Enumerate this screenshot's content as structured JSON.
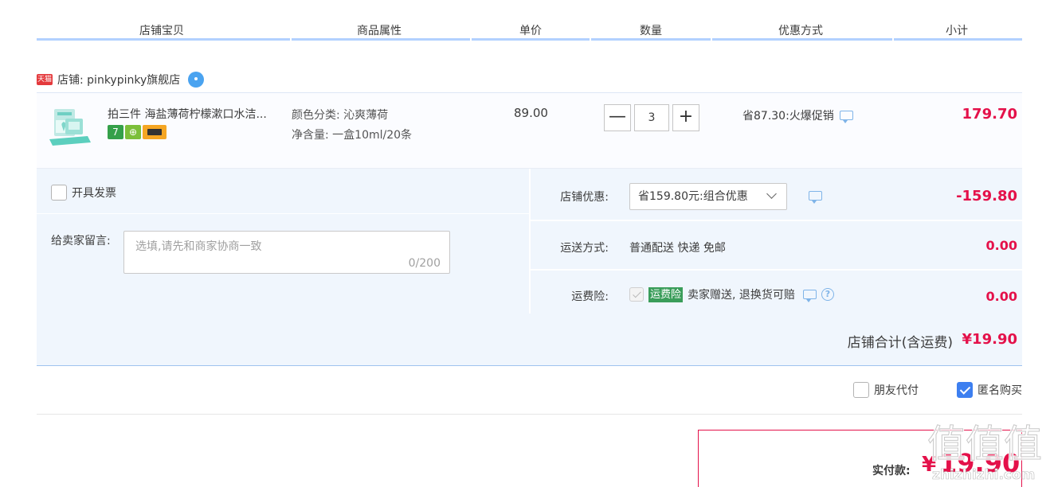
{
  "header": {
    "columns": [
      "店铺宝贝",
      "商品属性",
      "单价",
      "数量",
      "优惠方式",
      "小计"
    ]
  },
  "shop": {
    "badge": "天猫",
    "label": "店铺: pinkypinky旗舰店"
  },
  "item": {
    "title": "拍三件 海盐薄荷柠檬漱口水洁...",
    "attr_color": "颜色分类: 沁爽薄荷",
    "attr_volume": "净含量: 一盒10ml/20条",
    "price": "89.00",
    "quantity": "3",
    "qty_minus": "—",
    "qty_plus": "+",
    "promo": "省87.30:火爆促销",
    "subtotal": "179.70",
    "service_icons": [
      "7",
      "券",
      "card"
    ]
  },
  "options": {
    "invoice_label": "开具发票",
    "message_label": "给卖家留言:",
    "message_placeholder": "选填,请先和商家协商一致",
    "message_count": "0/200",
    "discount_label": "店铺优惠:",
    "discount_value": "省159.80元:组合优惠",
    "discount_amount": "-159.80",
    "shipping_label": "运送方式:",
    "shipping_value": "普通配送 快递 免邮",
    "shipping_amount": "0.00",
    "insurance_label": "运费险:",
    "insurance_badge": "运费险",
    "insurance_text": "卖家赠送, 退换货可赔",
    "insurance_amount": "0.00"
  },
  "total": {
    "label": "店铺合计(含运费)",
    "amount": "¥19.90"
  },
  "payment": {
    "friend_pay": "朋友代付",
    "anonymous": "匿名购买",
    "anonymous_checked": true
  },
  "final": {
    "label": "实付款:",
    "currency": "¥",
    "amount": "19.90"
  },
  "watermark": {
    "big": "值值值",
    "small": "zhizhizhi.com"
  },
  "colors": {
    "accent_red": "#e4114a",
    "panel_blue": "#f0f6fd",
    "header_line": "#b2d1ff",
    "checkbox_blue": "#3d7ff0"
  }
}
